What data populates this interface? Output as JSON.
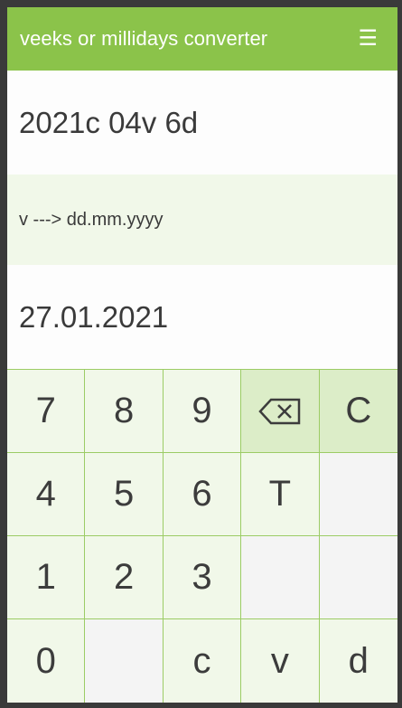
{
  "app": {
    "title": "veeks or millidays converter",
    "menu_icon": "hamburger-menu-icon"
  },
  "input": {
    "value": "2021c 04v 6d"
  },
  "mode": {
    "label": "v ---> dd.mm.yyyy"
  },
  "output": {
    "value": "27.01.2021"
  },
  "keypad": {
    "k7": "7",
    "k8": "8",
    "k9": "9",
    "backspace_icon": "backspace-icon",
    "clear": "C",
    "k4": "4",
    "k5": "5",
    "k6": "6",
    "today": "T",
    "k1": "1",
    "k2": "2",
    "k3": "3",
    "k0": "0",
    "c": "c",
    "v": "v",
    "d": "d"
  },
  "colors": {
    "header": "#8bc34a",
    "key_bg": "#f1f8e9",
    "key_accent": "#dcedc8",
    "key_border": "#9ccc65"
  }
}
